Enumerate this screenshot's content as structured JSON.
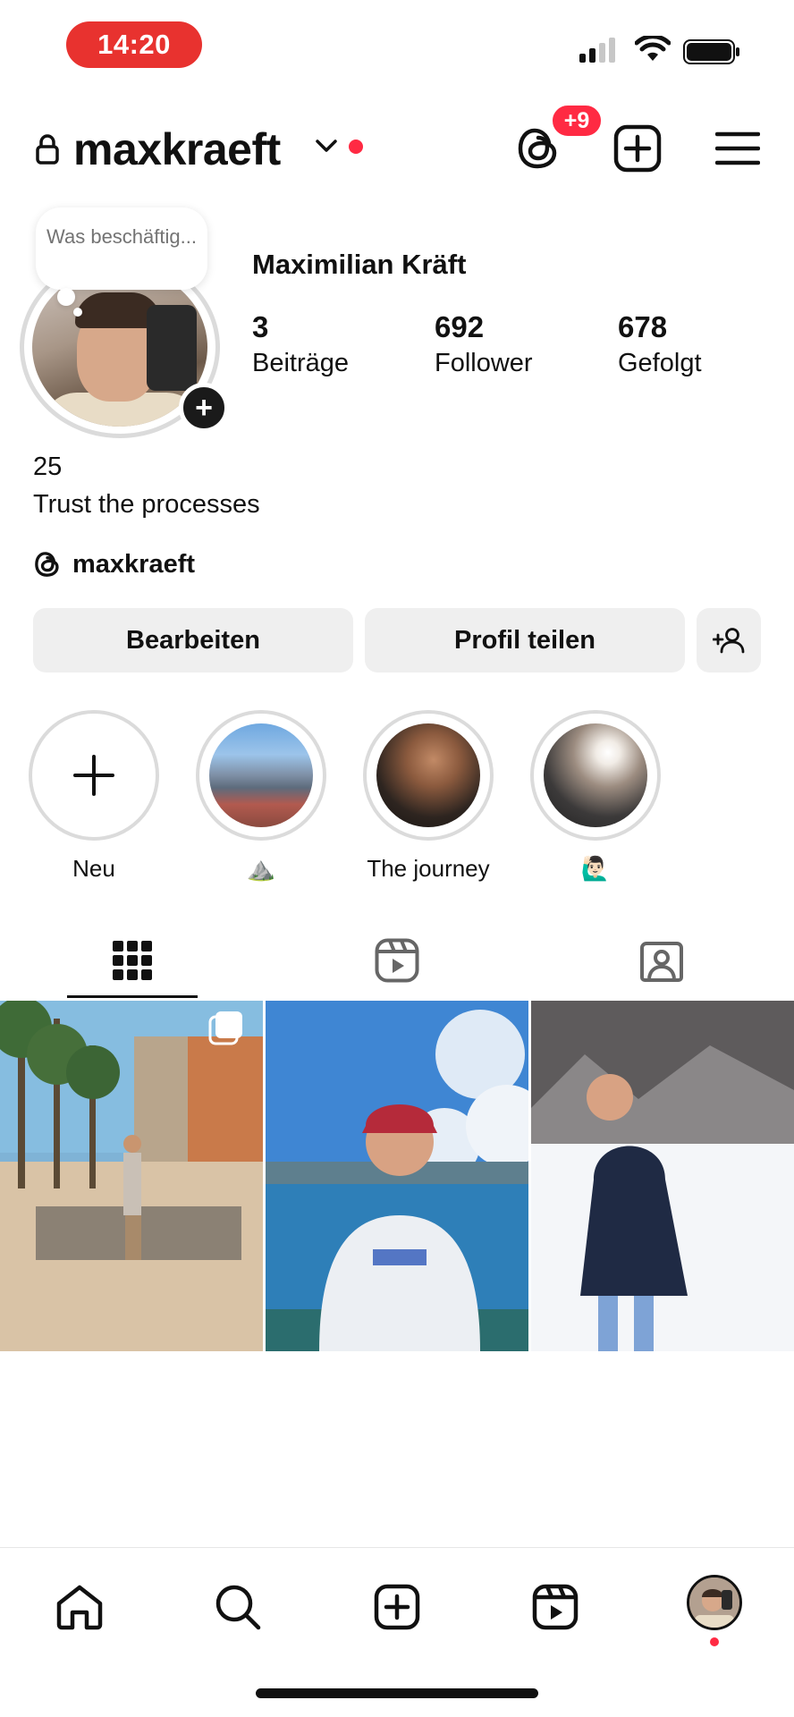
{
  "status_bar": {
    "time": "14:20"
  },
  "header": {
    "username": "maxkraeft",
    "threads_badge": "+9"
  },
  "profile": {
    "note_text": "Was beschäftig...",
    "full_name": "Maximilian Kräft",
    "stats": [
      {
        "value": "3",
        "label": "Beiträge"
      },
      {
        "value": "692",
        "label": "Follower"
      },
      {
        "value": "678",
        "label": "Gefolgt"
      }
    ],
    "bio_lines": [
      "25",
      "Trust the processes"
    ],
    "threads_handle": "maxkraeft"
  },
  "buttons": {
    "edit": "Bearbeiten",
    "share": "Profil teilen"
  },
  "highlights": [
    {
      "label": "Neu"
    },
    {
      "label": "⛰️"
    },
    {
      "label": "The journey"
    },
    {
      "label": "🙋🏻‍♂️"
    }
  ],
  "tabs": [
    "posts-grid-icon",
    "reels-icon",
    "tagged-icon"
  ],
  "colors": {
    "time_pill": "#e8322f",
    "badge": "#ff2a43",
    "button_bg": "#efefef",
    "ring": "#dbdbdb"
  }
}
